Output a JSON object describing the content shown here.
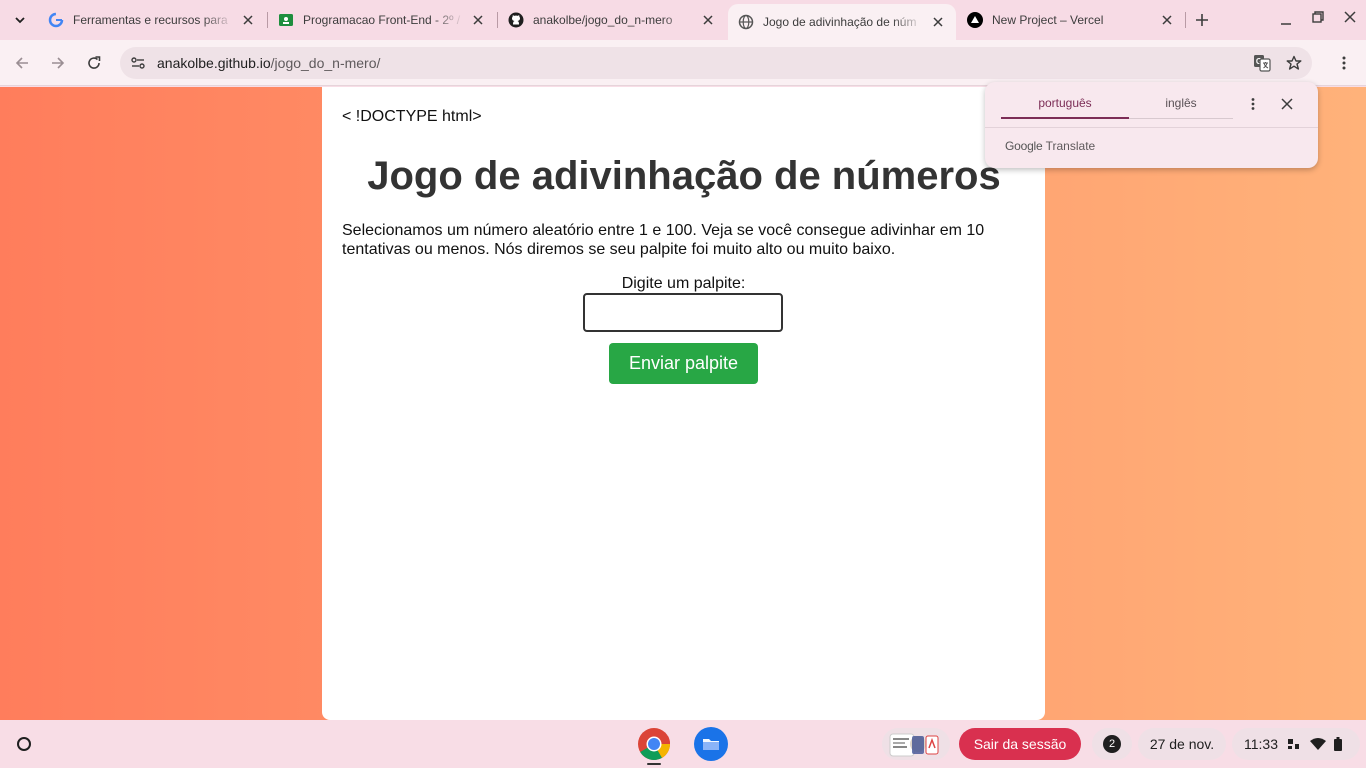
{
  "tabs": [
    {
      "title": "Ferramentas e recursos para",
      "icon": "google-icon"
    },
    {
      "title": "Programacao Front-End - 2º /",
      "icon": "classroom-icon"
    },
    {
      "title": "anakolbe/jogo_do_n-mero",
      "icon": "github-icon"
    },
    {
      "title": "Jogo de adivinhação de núm",
      "icon": "globe-icon",
      "active": true
    },
    {
      "title": "New Project – Vercel",
      "icon": "vercel-icon"
    }
  ],
  "address_bar": {
    "host": "anakolbe.github.io",
    "path": "/jogo_do_n-mero/"
  },
  "page": {
    "doctype_text": "< !DOCTYPE html>",
    "heading": "Jogo de adivinhação de números",
    "description": "Selecionamos um número aleatório entre 1 e 100. Veja se você consegue adivinhar em 10 tentativas ou menos. Nós diremos se seu palpite foi muito alto ou muito baixo.",
    "guess_label": "Digite um palpite:",
    "guess_value": "",
    "submit_label": "Enviar palpite"
  },
  "translate_popup": {
    "source_language": "português",
    "target_language": "inglês",
    "brand_google": "Google",
    "brand_translate": "Translate"
  },
  "shelf": {
    "logout_label": "Sair da sessão",
    "notification_count": "2",
    "date": "27 de nov.",
    "time": "11:33"
  },
  "colors": {
    "page_gradient_start": "#ff7d5c",
    "page_gradient_end": "#ffb27a",
    "submit_button": "#28a745",
    "logout_button": "#d9304f",
    "translate_accent": "#7c2d56"
  }
}
